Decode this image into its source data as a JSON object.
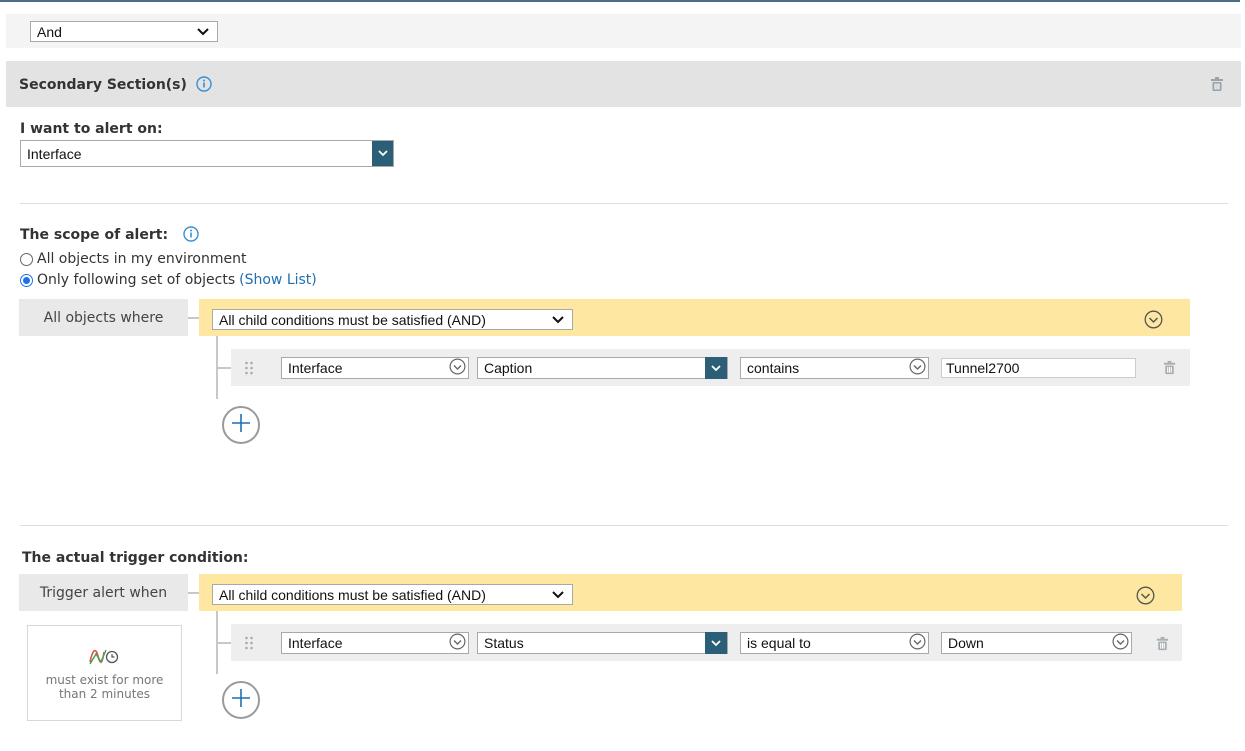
{
  "top_operator": {
    "value": "And"
  },
  "section": {
    "title": "Secondary Section(s)"
  },
  "alert_on": {
    "label": "I want to alert on:",
    "value": "Interface"
  },
  "scope": {
    "label": "The scope of alert:",
    "option_all": "All objects in my environment",
    "option_following": "Only following set of objects",
    "show_list": "(Show List)",
    "where_label": "All objects where",
    "group_operator": "All child conditions must be satisfied (AND)",
    "condition": {
      "object": "Interface",
      "field": "Caption",
      "operator": "contains",
      "value": "Tunnel2700"
    }
  },
  "trigger": {
    "label": "The actual trigger condition:",
    "when_label": "Trigger alert when",
    "group_operator": "All child conditions must be satisfied (AND)",
    "condition": {
      "object": "Interface",
      "field": "Status",
      "operator": "is equal to",
      "value": "Down"
    },
    "duration_line1": "must exist for more",
    "duration_line2": "than 2 minutes"
  },
  "colors": {
    "accent_teal": "#2b5f78",
    "yellow_bar": "#fde7a1",
    "link_blue": "#1f6fb2",
    "info_blue": "#3b8fd0"
  }
}
